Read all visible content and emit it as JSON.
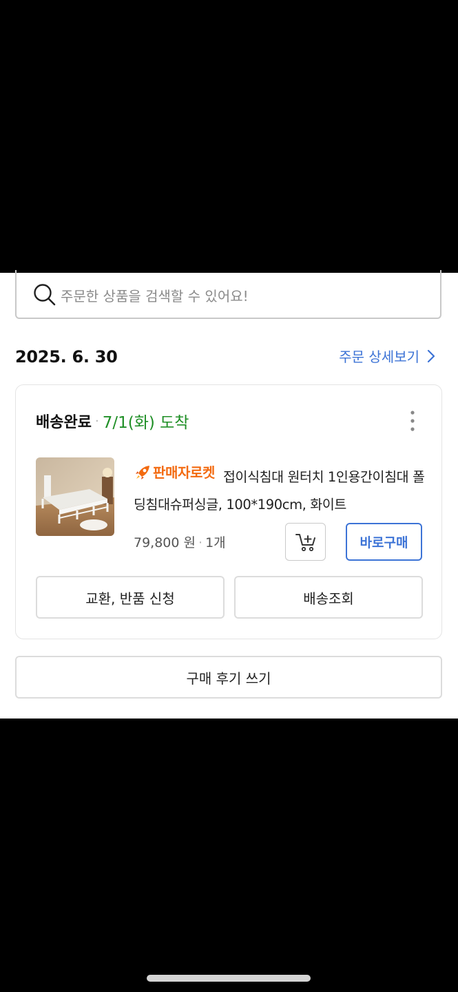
{
  "search": {
    "placeholder": "주문한 상품을 검색할 수 있어요!"
  },
  "order": {
    "date": "2025. 6. 30",
    "detail_link": "주문 상세보기",
    "status": "배송완료",
    "separator": "·",
    "arrival": "7/1(화) 도착",
    "product": {
      "seller_badge": "판매자로켓",
      "title": "접이식침대 원터치 1인용간이침대 폴딩침대슈퍼싱글, 100*190cm, 화이트",
      "price": "79,800 원",
      "quantity": "1개"
    },
    "buttons": {
      "buy_now": "바로구매",
      "exchange_return": "교환, 반품 신청",
      "tracking": "배송조회",
      "write_review": "구매 후기 쓰기"
    }
  },
  "colors": {
    "accent_blue": "#3c73d6",
    "arrival_green": "#1f8f26",
    "seller_orange": "#f36a10"
  },
  "icons": [
    "search-icon",
    "chevron-right-icon",
    "more-vertical-icon",
    "rocket-icon",
    "add-to-cart-icon"
  ]
}
